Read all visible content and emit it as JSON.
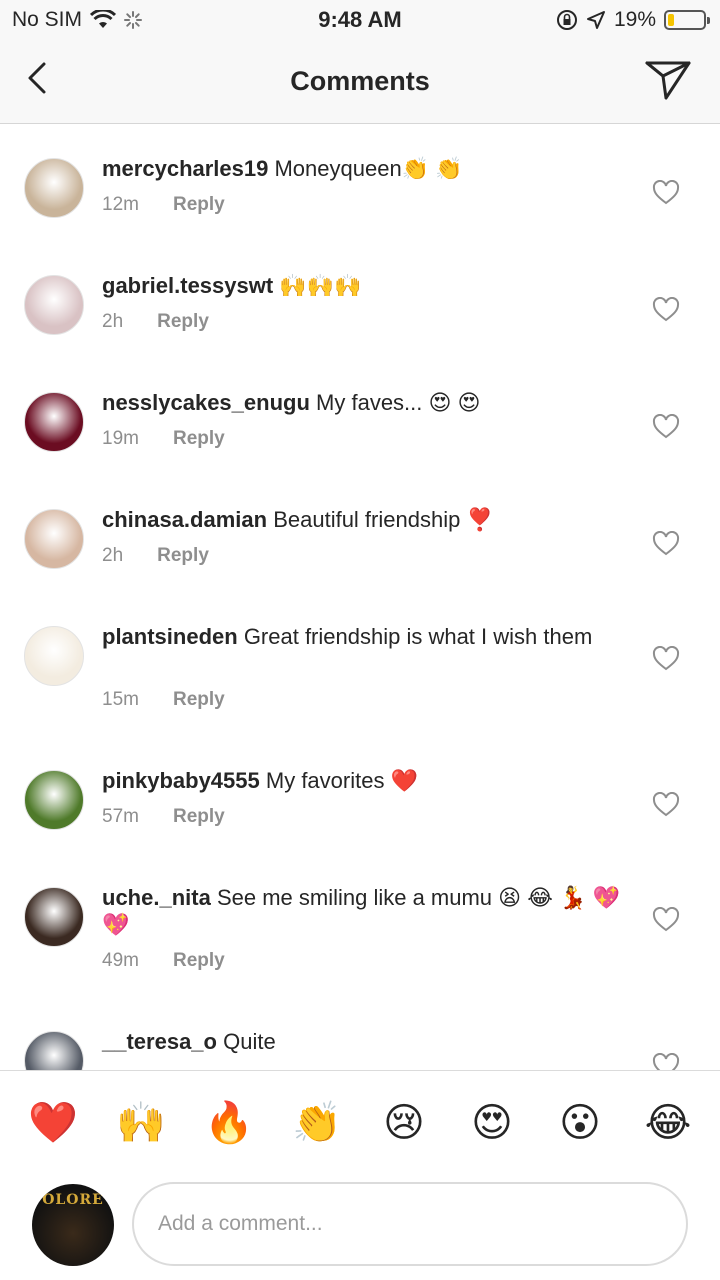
{
  "status_bar": {
    "carrier": "No SIM",
    "time": "9:48 AM",
    "battery": "19%",
    "battery_level": 0.19
  },
  "header": {
    "title": "Comments"
  },
  "comments": [
    {
      "username": "mercycharles19",
      "text": "Moneyqueen👏 👏",
      "time": "12m",
      "reply": "Reply",
      "avatar_color": "#c9b49a"
    },
    {
      "username": "gabriel.tessyswt",
      "text": "🙌🙌🙌",
      "time": "2h",
      "reply": "Reply",
      "avatar_color": "#d9c2c4"
    },
    {
      "username": "nesslycakes_enugu",
      "text": "My faves... 😍 😍",
      "time": "19m",
      "reply": "Reply",
      "avatar_color": "#6b0d22"
    },
    {
      "username": "chinasa.damian",
      "text": "Beautiful friendship  ❣️",
      "time": "2h",
      "reply": "Reply",
      "avatar_color": "#d6b7a2"
    },
    {
      "username": "plantsineden",
      "text": "Great friendship is what I wish them",
      "time": "15m",
      "reply": "Reply",
      "avatar_color": "#f3ece0"
    },
    {
      "username": "pinkybaby4555",
      "text": "My favorites  ❤️",
      "time": "57m",
      "reply": "Reply",
      "avatar_color": "#4f7a2a"
    },
    {
      "username": "uche._nita",
      "text": "See me smiling like a mumu 😫 😂 💃 💖 💖",
      "time": "49m",
      "reply": "Reply",
      "avatar_color": "#3b2a22"
    },
    {
      "username": "__teresa_o",
      "text": "Quite",
      "time": "",
      "reply": "",
      "avatar_color": "#555b66"
    }
  ],
  "emoji_bar": [
    "❤️",
    "🙌",
    "🔥",
    "👏",
    "😢",
    "😍",
    "😮",
    "😂"
  ],
  "compose": {
    "avatar_text": "OLORE",
    "placeholder": "Add a comment..."
  },
  "colors": {
    "text": "#262626",
    "muted": "#8e8e8e",
    "border": "#dbdbdb",
    "battery": "#f5c400"
  }
}
